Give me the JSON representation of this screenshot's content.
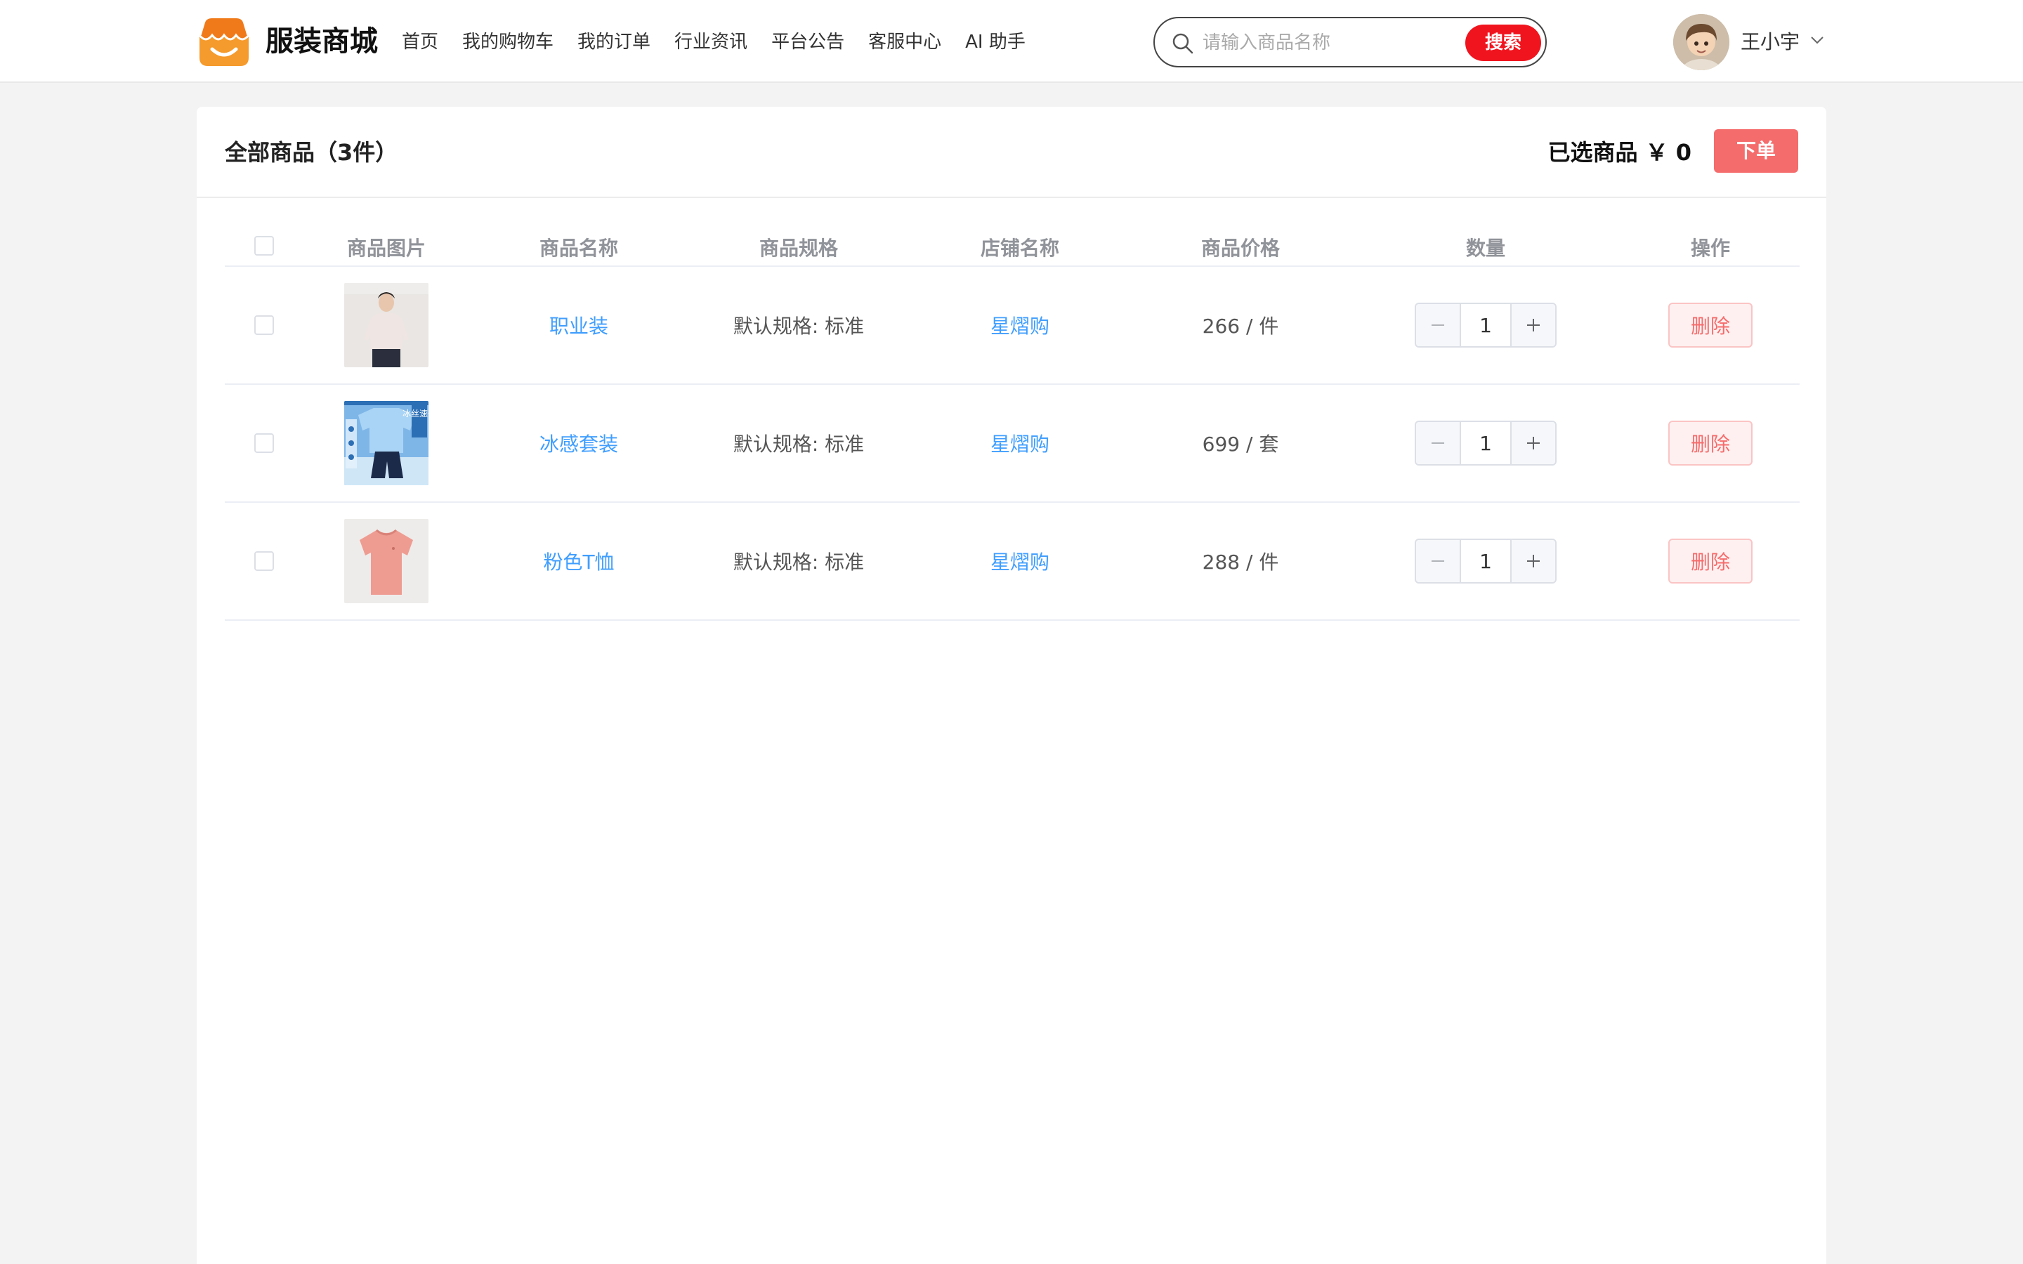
{
  "header": {
    "brand": "服装商城",
    "nav": [
      "首页",
      "我的购物车",
      "我的订单",
      "行业资讯",
      "平台公告",
      "客服中心",
      "AI 助手"
    ],
    "search": {
      "placeholder": "请输入商品名称",
      "value": "",
      "button": "搜索"
    },
    "user": {
      "name": "王小宇"
    }
  },
  "cart": {
    "title": "全部商品（3件）",
    "selected_label": "已选商品 ￥ 0",
    "order_button": "下单",
    "columns": [
      "商品图片",
      "商品名称",
      "商品规格",
      "店铺名称",
      "商品价格",
      "数量",
      "操作"
    ],
    "items": [
      {
        "name": "职业装",
        "spec": "默认规格: 标准",
        "shop": "星熠购",
        "price": "266 / 件",
        "qty": "1",
        "delete": "删除"
      },
      {
        "name": "冰感套装",
        "spec": "默认规格: 标准",
        "shop": "星熠购",
        "price": "699 / 套",
        "qty": "1",
        "delete": "删除",
        "image_text": "冰丝速干"
      },
      {
        "name": "粉色T恤",
        "spec": "默认规格: 标准",
        "shop": "星熠购",
        "price": "288 / 件",
        "qty": "1",
        "delete": "删除"
      }
    ]
  },
  "colors": {
    "accent_red": "#f0141e",
    "order_button": "#f56c6c",
    "link": "#409eff",
    "logo_orange": "#f07a1a"
  },
  "icons": {
    "logo": "shop-bag-smile-icon",
    "search": "search-icon",
    "chevron": "chevron-down-icon",
    "minus": "minus-icon",
    "plus": "plus-icon"
  }
}
